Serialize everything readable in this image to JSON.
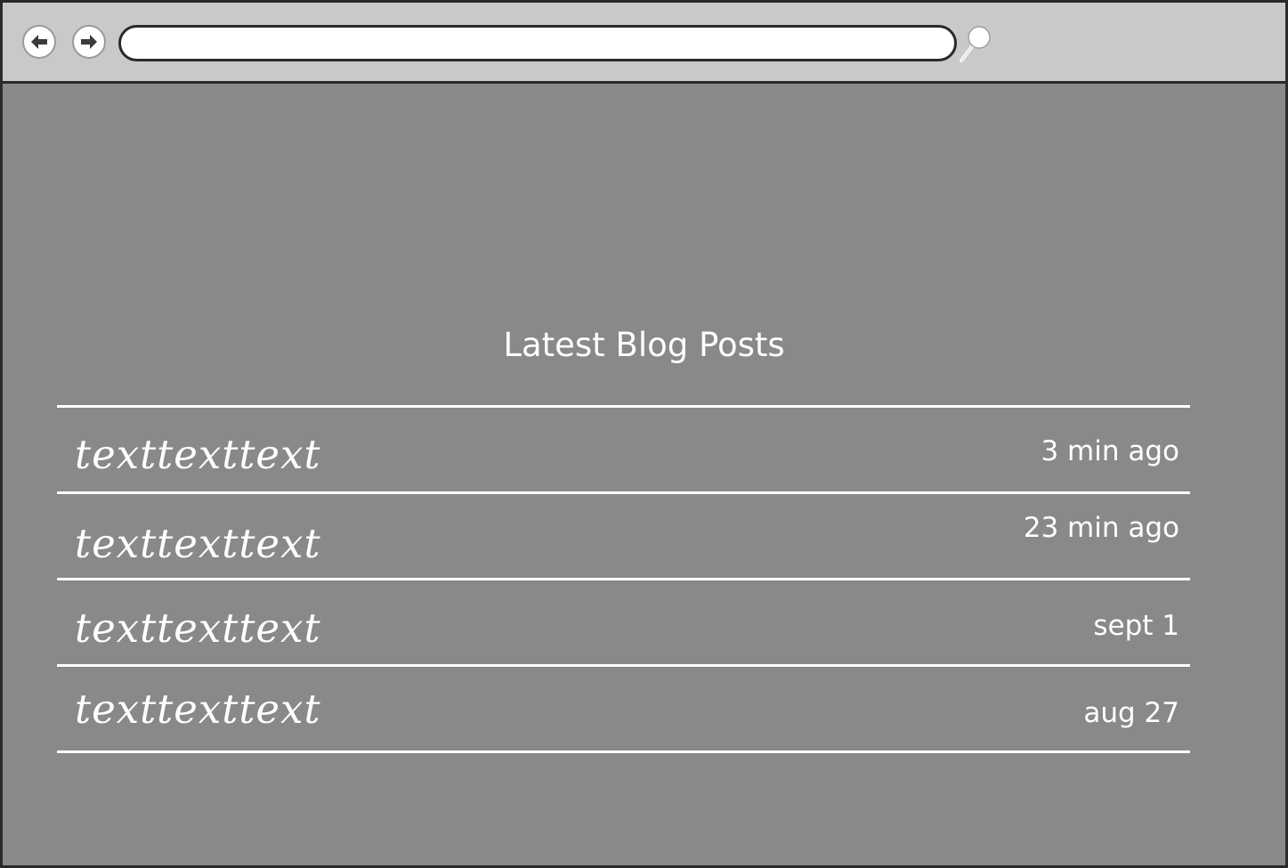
{
  "browser": {
    "back_icon": "arrow-left-icon",
    "forward_icon": "arrow-right-icon",
    "address_value": "",
    "search_icon": "magnifier-icon"
  },
  "page": {
    "title": "Latest Blog Posts",
    "posts": [
      {
        "title": "texttexttext",
        "time": "3 min ago"
      },
      {
        "title": "texttexttext",
        "time": "23 min ago"
      },
      {
        "title": "texttexttext",
        "time": "sept 1"
      },
      {
        "title": "texttexttext",
        "time": "aug 27"
      }
    ]
  },
  "colors": {
    "toolbar": "#c9c9c9",
    "page_background": "#898989",
    "text": "#ffffff",
    "border": "#2a2a2a"
  }
}
